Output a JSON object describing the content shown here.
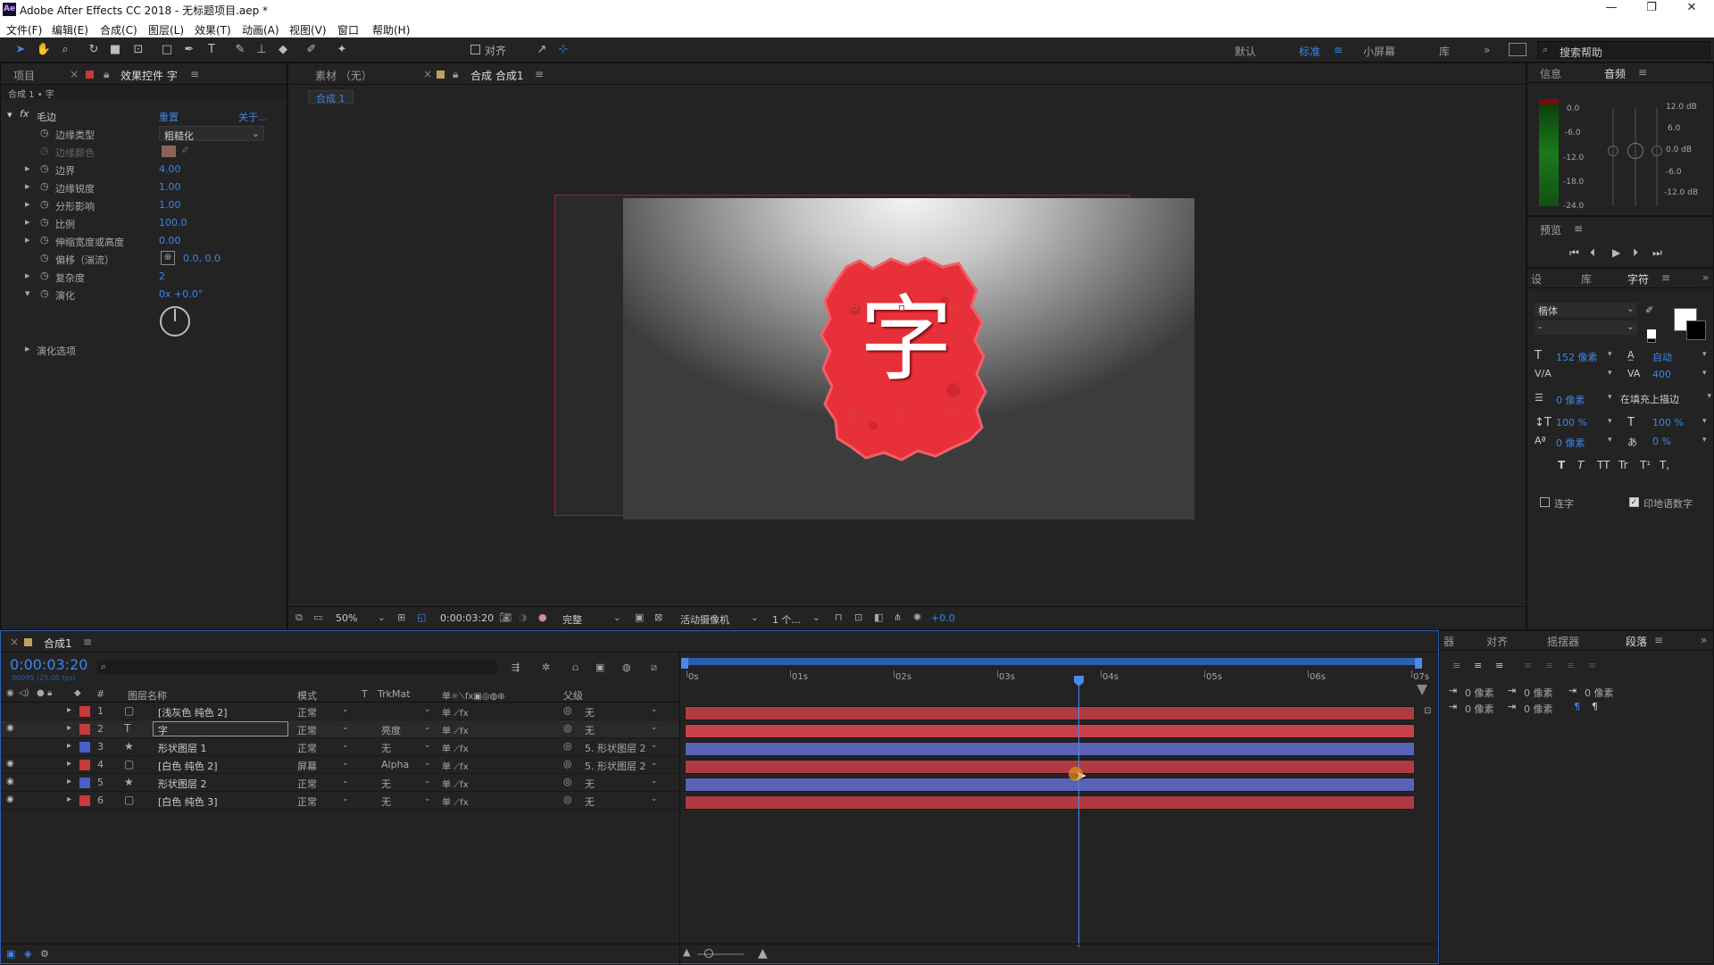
{
  "app": {
    "title": "Adobe After Effects CC 2018 - 无标题项目.aep *",
    "icon_text": "Ae"
  },
  "menu": [
    "文件(F)",
    "编辑(E)",
    "合成(C)",
    "图层(L)",
    "效果(T)",
    "动画(A)",
    "视图(V)",
    "窗口",
    "帮助(H)"
  ],
  "toolbar": {
    "align_label": "对齐",
    "workspaces": [
      "默认",
      "标准",
      "小屏幕",
      "库"
    ],
    "search_placeholder": "搜索帮助"
  },
  "left_panel": {
    "tab_project": "项目",
    "tab_effects": "效果控件 字",
    "breadcrumb": "合成 1 • 字",
    "effect_name": "毛边",
    "reset": "重置",
    "about": "关于...",
    "props": [
      {
        "name": "边缘类型",
        "value": "粗糙化"
      },
      {
        "name": "边缘颜色",
        "value": ""
      },
      {
        "name": "边界",
        "value": "4.00"
      },
      {
        "name": "边缘锐度",
        "value": "1.00"
      },
      {
        "name": "分形影响",
        "value": "1.00"
      },
      {
        "name": "比例",
        "value": "100.0"
      },
      {
        "name": "伸缩宽度或高度",
        "value": "0.00"
      },
      {
        "name": "偏移（湍流）",
        "value": "0.0, 0.0"
      },
      {
        "name": "复杂度",
        "value": "2"
      },
      {
        "name": "演化",
        "value": "0x +0.0°"
      }
    ],
    "evolution_options": "演化选项"
  },
  "viewer": {
    "tab_footage": "素材 （无）",
    "tab_comp": "合成 合成1",
    "comp_chip": "合成 1",
    "character": "字",
    "zoom": "50%",
    "timecode": "0:00:03:20",
    "quality": "完整",
    "camera": "活动摄像机",
    "views": "1 个...",
    "exposure": "+0.0"
  },
  "audio_panel": {
    "tab_info": "信息",
    "tab_audio": "音频",
    "left_scale": [
      "0.0",
      "-6.0",
      "-12.0",
      "-18.0",
      "-24.0"
    ],
    "right_scale": [
      "12.0 dB",
      "6.0",
      "0.0 dB",
      "-6.0",
      "-12.0 dB"
    ],
    "tab_preview": "预览"
  },
  "char_panel": {
    "tab_settings": "设",
    "tab_library": "库",
    "tab_char": "字符",
    "font": "楷体",
    "style": "-",
    "size": "152 像素",
    "leading": "自动",
    "kerning": "",
    "tracking": "400",
    "stroke": "0 像素",
    "stroke_mode": "在填充上描边",
    "vscale": "100 %",
    "hscale": "100 %",
    "baseline": "0 像素",
    "tsume": "0 %",
    "styles": [
      "T",
      "T",
      "TT",
      "Tr",
      "T¹",
      "T,"
    ],
    "ligature": "连字",
    "hindi": "印地语数字"
  },
  "timeline": {
    "tab": "合成1",
    "timecode": "0:00:03:20",
    "frames": "00095 (25.00 fps)",
    "col_name": "图层名称",
    "col_mode": "模式",
    "col_t": "T",
    "col_trkmat": "TrkMat",
    "col_parent": "父级",
    "ruler": [
      "0s",
      "01s",
      "02s",
      "03s",
      "04s",
      "05s",
      "06s",
      "07s"
    ],
    "layers": [
      {
        "num": "1",
        "name": "[浅灰色 纯色 2]",
        "mode": "正常",
        "trkmat": "",
        "parent": "无",
        "color": "#c83a3a",
        "bar": "#b03a42",
        "eye": false
      },
      {
        "num": "2",
        "name": "字",
        "mode": "正常",
        "trkmat": "亮度",
        "parent": "无",
        "color": "#c83a3a",
        "bar": "#c8404a",
        "eye": true
      },
      {
        "num": "3",
        "name": "形状图层 1",
        "mode": "正常",
        "trkmat": "无",
        "parent": "5. 形状图层 2",
        "color": "#4a5fc8",
        "bar": "#5a62b8",
        "eye": false
      },
      {
        "num": "4",
        "name": "[白色 纯色 2]",
        "mode": "屏幕",
        "trkmat": "Alpha",
        "parent": "5. 形状图层 2",
        "color": "#c83a3a",
        "bar": "#b03a42",
        "eye": true
      },
      {
        "num": "5",
        "name": "形状图层 2",
        "mode": "正常",
        "trkmat": "无",
        "parent": "无",
        "color": "#4a5fc8",
        "bar": "#5a62b8",
        "eye": true
      },
      {
        "num": "6",
        "name": "[白色 纯色 3]",
        "mode": "正常",
        "trkmat": "无",
        "parent": "无",
        "color": "#c83a3a",
        "bar": "#b03a42",
        "eye": true
      }
    ]
  },
  "para_panel": {
    "tabs": [
      "器",
      "对齐",
      "摇摆器",
      "段落"
    ],
    "indent": [
      "0 像素",
      "0 像素",
      "0 像素",
      "0 像素",
      "0 像素"
    ]
  }
}
